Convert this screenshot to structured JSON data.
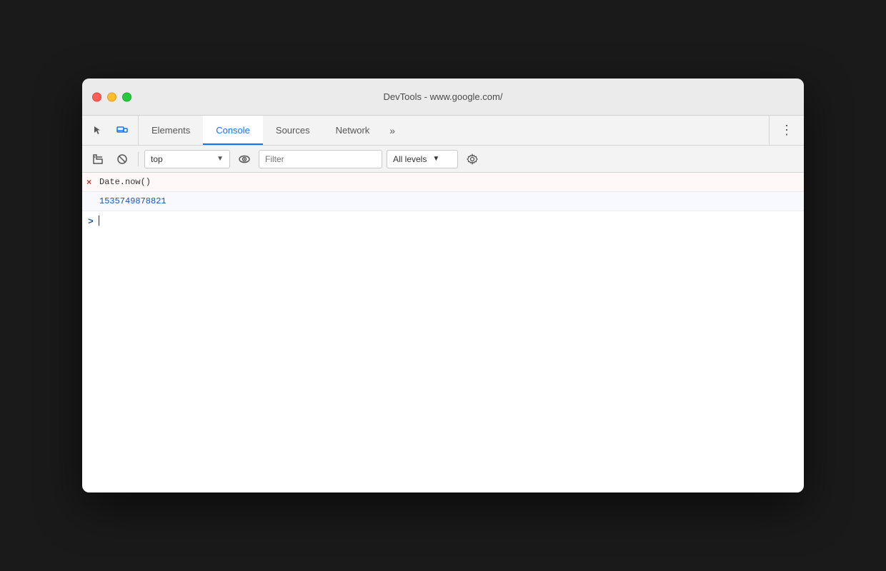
{
  "window": {
    "title": "DevTools - www.google.com/"
  },
  "traffic_lights": {
    "close": "close",
    "minimize": "minimize",
    "maximize": "maximize"
  },
  "tabs": {
    "items": [
      {
        "id": "elements",
        "label": "Elements",
        "active": false
      },
      {
        "id": "console",
        "label": "Console",
        "active": true
      },
      {
        "id": "sources",
        "label": "Sources",
        "active": false
      },
      {
        "id": "network",
        "label": "Network",
        "active": false
      }
    ],
    "more_label": "»",
    "more_menu_label": "⋮"
  },
  "toolbar": {
    "clear_label": "▶|",
    "block_label": "🚫",
    "context_value": "top",
    "context_arrow": "▼",
    "filter_placeholder": "Filter",
    "levels_label": "All levels",
    "levels_arrow": "▼"
  },
  "console": {
    "entry_icon": "×",
    "command_text": "Date.now()",
    "result_text": "1535749878821",
    "prompt_chevron": ">"
  }
}
